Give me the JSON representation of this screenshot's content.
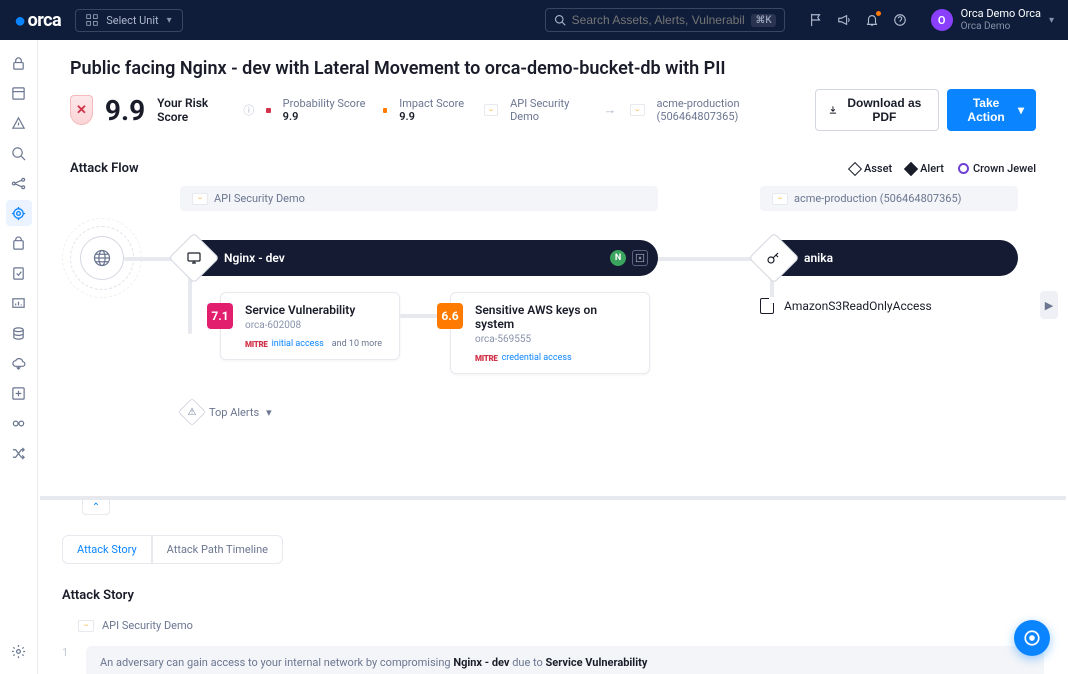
{
  "header": {
    "logo": "orca",
    "unitSelector": {
      "icon": "grid",
      "label": "Select Unit"
    },
    "search": {
      "placeholder": "Search Assets, Alerts, Vulnerabilities",
      "shortcut": "⌘K"
    },
    "user": {
      "initial": "O",
      "name": "Orca Demo Orca",
      "org": "Orca Demo"
    }
  },
  "page": {
    "title": "Public facing Nginx - dev with Lateral Movement to orca-demo-bucket-db with PII",
    "score": "9.9",
    "riskLabel": "Your Risk Score",
    "probLabel": "Probability Score",
    "probVal": "9.9",
    "impactLabel": "Impact Score",
    "impactVal": "9.9",
    "env1": "API Security Demo",
    "env2": "acme-production (506464807365)",
    "downloadBtn": "Download as PDF",
    "actionBtn": "Take Action"
  },
  "flow": {
    "title": "Attack Flow",
    "legend": {
      "asset": "Asset",
      "alert": "Alert",
      "crown": "Crown Jewel"
    },
    "envPill1": "API Security Demo",
    "envPill2": "acme-production (506464807365)",
    "node1": "Nginx - dev",
    "node2": "anika",
    "alert1": {
      "score": "7.1",
      "title": "Service Vulnerability",
      "id": "orca-602008",
      "mitre": "initial access",
      "more": "and 10 more"
    },
    "alert2": {
      "score": "6.6",
      "title": "Sensitive AWS keys on system",
      "id": "orca-569555",
      "mitre": "credential access"
    },
    "policy": "AmazonS3ReadOnlyAccess",
    "topAlerts": "Top Alerts"
  },
  "tabs": {
    "story": "Attack Story",
    "timeline": "Attack Path Timeline"
  },
  "story": {
    "title": "Attack Story",
    "contextLabel": "API Security Demo",
    "step1_pre": "An adversary can gain access to your internal network by compromising ",
    "step1_b1": "Nginx - dev",
    "step1_mid": " due to ",
    "step1_b2": "Service Vulnerability"
  }
}
